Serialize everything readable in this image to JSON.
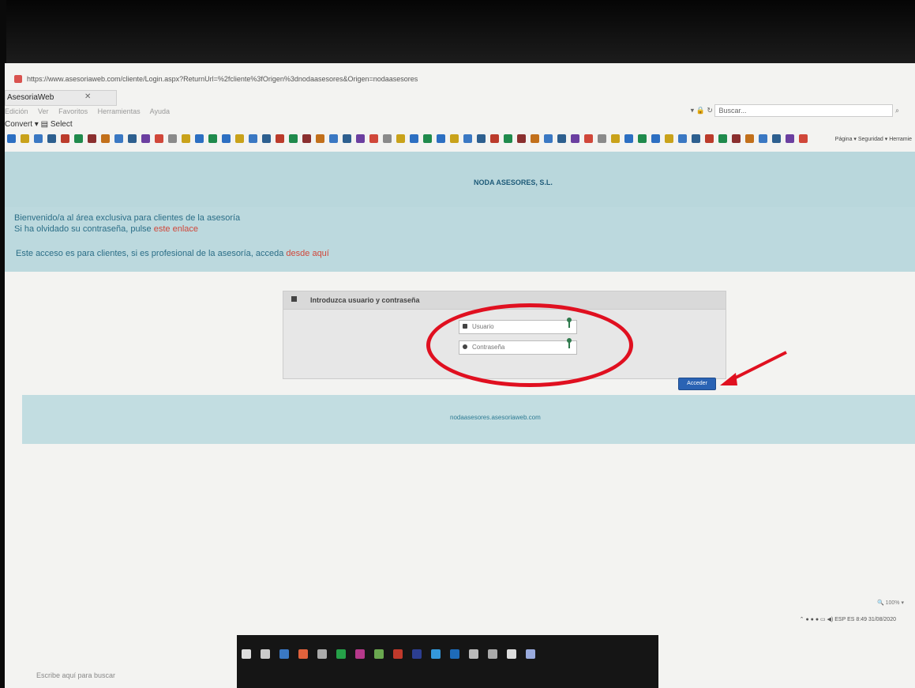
{
  "browser": {
    "url": "https://www.asesoriaweb.com/cliente/Login.aspx?ReturnUrl=%2fcliente%3fOrigen%3dnodaasesores&Origen=nodaasesores",
    "tab_title": "AsesoriaWeb",
    "search_placeholder": "Buscar...",
    "menu": [
      "Edición",
      "Ver",
      "Favoritos",
      "Herramientas",
      "Ayuda"
    ],
    "convert_label": "Convert",
    "select_label": "Select",
    "toolbar_right": [
      "Página",
      "Seguridad",
      "Herramie"
    ]
  },
  "page": {
    "company": "NODA ASESORES, S.L.",
    "welcome_line": "Bienvenido/a al área exclusiva para clientes de la asesoría",
    "forgot_prefix": "Si ha olvidado su contraseña, pulse",
    "forgot_link": "este enlace",
    "pro_prefix": "Este acceso es para clientes, si es profesional de la asesoría, acceda",
    "pro_link": "desde aquí",
    "login_title": "Introduzca usuario y contraseña",
    "username_placeholder": "Usuario",
    "password_placeholder": "Contraseña",
    "submit_label": "Acceder",
    "footer_link": "nodaasesores.asesoriaweb.com"
  },
  "system": {
    "zoom": "100%",
    "lang": "ESP",
    "lang_sub": "ES",
    "time": "8:49",
    "date": "31/08/2020",
    "taskbar_search": "Escribe aquí para buscar"
  },
  "colors": {
    "band": "#b9d7dc",
    "link": "#d0473a",
    "button": "#2a63b4",
    "annotation": "#e01020"
  }
}
